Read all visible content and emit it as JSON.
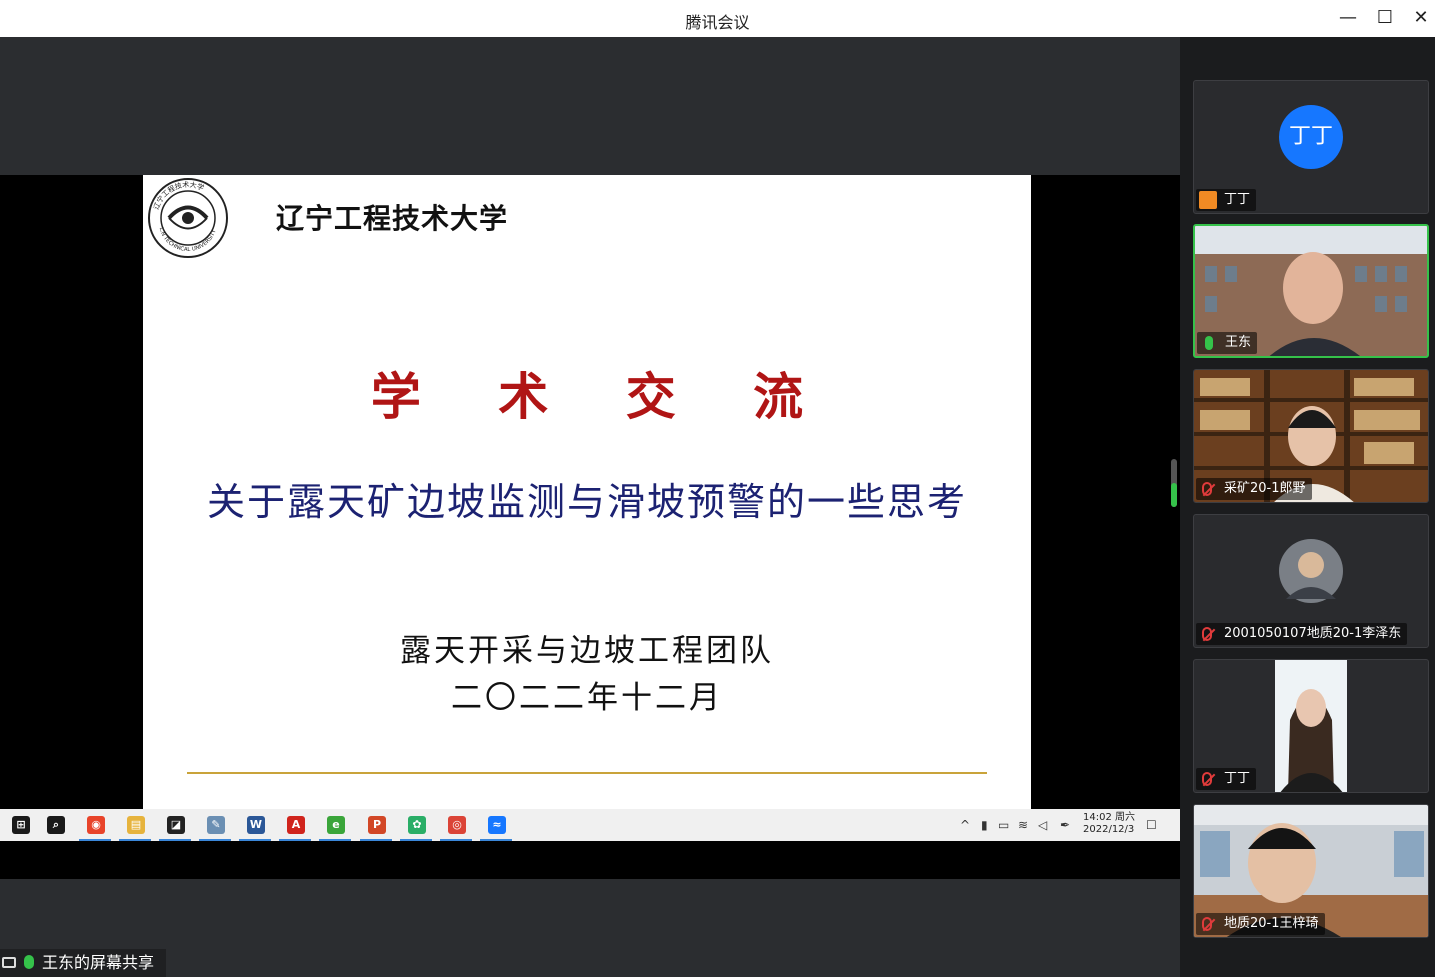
{
  "window": {
    "title": "腾讯会议",
    "minimize": "—",
    "maximize": "☐",
    "close": "✕"
  },
  "slide": {
    "university": "辽宁工程技术大学",
    "logo_text": "辽宁工程技术大学 L.N TECHNICAL UNIVERSITY",
    "heading": "学 术 交 流",
    "subtitle": "关于露天矿边坡监测与滑坡预警的一些思考",
    "team": "露天开采与边坡工程团队",
    "date": "二〇二二年十二月",
    "colors": {
      "heading": "#b01515",
      "subtitle": "#1c2272",
      "rule": "#c9a33a"
    }
  },
  "taskbar": {
    "apps": [
      {
        "name": "start-icon",
        "glyph": "⊞",
        "color": "#1a1a1a"
      },
      {
        "name": "search-icon",
        "glyph": "⌕",
        "color": "#1a1a1a"
      },
      {
        "name": "browser-360-icon",
        "glyph": "◉",
        "color": "#e8442a"
      },
      {
        "name": "file-explorer-icon",
        "glyph": "▤",
        "color": "#e6b33d"
      },
      {
        "name": "sticky-notes-icon",
        "glyph": "◪",
        "color": "#222"
      },
      {
        "name": "notepad-icon",
        "glyph": "✎",
        "color": "#6b8fb3"
      },
      {
        "name": "word-icon",
        "glyph": "W",
        "color": "#2b5797"
      },
      {
        "name": "pdf-reader-icon",
        "glyph": "A",
        "color": "#d0241c"
      },
      {
        "name": "ie-browser-icon",
        "glyph": "e",
        "color": "#3aa53a"
      },
      {
        "name": "powerpoint-icon",
        "glyph": "P",
        "color": "#d24726"
      },
      {
        "name": "wechat-icon",
        "glyph": "✿",
        "color": "#2aae67"
      },
      {
        "name": "chrome-icon",
        "glyph": "◎",
        "color": "#db4437"
      },
      {
        "name": "tencent-meeting-icon",
        "glyph": "≈",
        "color": "#1677ff"
      }
    ],
    "tray": {
      "chevron": "^",
      "mic": "▮",
      "battery": "▭",
      "wifi": "≋",
      "volume": "◁",
      "pen": "✒",
      "notify": "☐"
    },
    "time": "14:02 周六",
    "date": "2022/12/3"
  },
  "share_label": "王东的屏幕共享",
  "participants": [
    {
      "name": "丁丁",
      "avatar_text": "丁丁",
      "mode": "avatar",
      "status": "person"
    },
    {
      "name": "王东",
      "mode": "video",
      "status": "mic-on"
    },
    {
      "name": "采矿20-1郎野",
      "mode": "video",
      "status": "mic-off"
    },
    {
      "name": "2001050107地质20-1李泽东",
      "mode": "photo",
      "status": "mic-off"
    },
    {
      "name": "丁丁",
      "mode": "photo",
      "status": "mic-off"
    },
    {
      "name": "地质20-1王梓琦",
      "mode": "video",
      "status": "mic-off"
    }
  ]
}
